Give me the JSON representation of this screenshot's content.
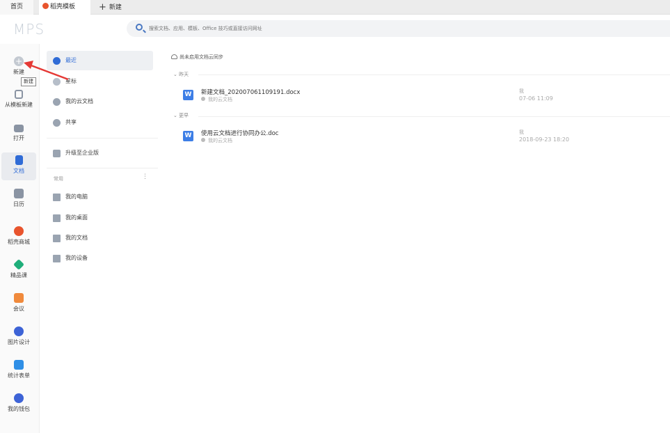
{
  "tabs": {
    "home": "首页",
    "daoke": "稻壳模板",
    "new": "新建"
  },
  "brand": "MPS",
  "search": {
    "placeholder": "搜索文档、应用、模板、Office 技巧或直接访问网址"
  },
  "leftbar": {
    "items": [
      {
        "label": "新建",
        "icon": "plus-circle-icon"
      },
      {
        "label": "从模板新建",
        "icon": "template-new-icon"
      },
      {
        "label": "打开",
        "icon": "folder-icon"
      },
      {
        "label": "文档",
        "icon": "document-icon"
      },
      {
        "label": "日历",
        "icon": "calendar-icon"
      },
      {
        "label": "稻壳商城",
        "icon": "daoke-store-icon"
      },
      {
        "label": "精品课",
        "icon": "graduation-cap-icon"
      },
      {
        "label": "会议",
        "icon": "meeting-icon"
      },
      {
        "label": "图片设计",
        "icon": "image-design-icon"
      },
      {
        "label": "统计表单",
        "icon": "stats-form-icon"
      },
      {
        "label": "我的钱包",
        "icon": "wallet-icon"
      }
    ],
    "tooltip": "新建"
  },
  "nav": {
    "items": [
      {
        "label": "最近",
        "icon": "clock-icon"
      },
      {
        "label": "星标",
        "icon": "star-icon"
      },
      {
        "label": "我的云文档",
        "icon": "cloud-doc-icon"
      },
      {
        "label": "共享",
        "icon": "share-people-icon"
      }
    ],
    "upgrade": "升级至企业版",
    "section_label": "常用",
    "section_dots": "⋮",
    "common": [
      {
        "label": "我的电脑",
        "icon": "computer-icon"
      },
      {
        "label": "我的桌面",
        "icon": "desktop-icon"
      },
      {
        "label": "我的文档",
        "icon": "my-docs-icon"
      },
      {
        "label": "我的设备",
        "icon": "devices-icon"
      }
    ]
  },
  "content": {
    "sync_notice": "尚未启用文档云同步",
    "groups": [
      {
        "header": "昨天",
        "files": [
          {
            "name": "新建文档_202007061109191.docx",
            "location": "我的云文档",
            "owner": "我",
            "date": "07-06 11:09"
          }
        ]
      },
      {
        "header": "更早",
        "files": [
          {
            "name": "使用云文档进行协同办公.doc",
            "location": "我的云文档",
            "owner": "我",
            "date": "2018-09-23 18:20"
          }
        ]
      }
    ]
  },
  "colors": {
    "accent": "#2f6bd6",
    "word_icon": "#3d7ee6",
    "annotation_arrow": "#e53935"
  }
}
